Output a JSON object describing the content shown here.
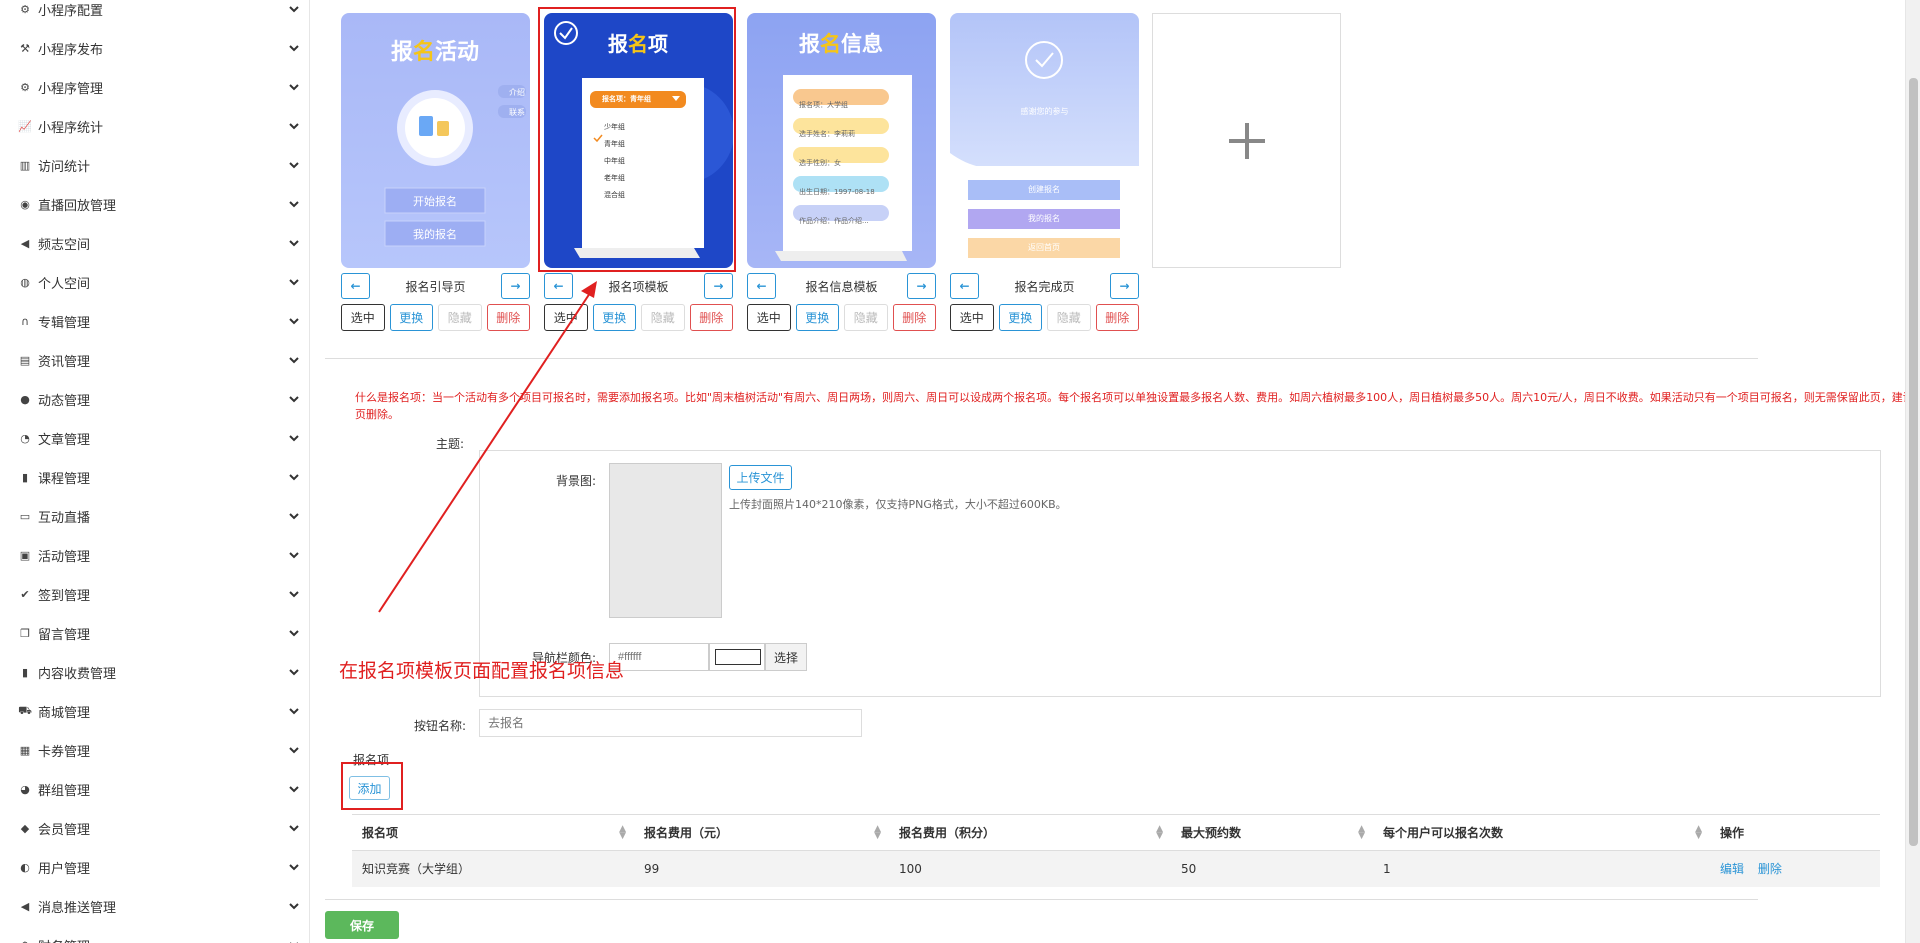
{
  "sidebar": {
    "items": [
      {
        "label": "小程序配置",
        "icon": "cogs-icon"
      },
      {
        "label": "小程序发布",
        "icon": "gavel-icon"
      },
      {
        "label": "小程序管理",
        "icon": "gear-icon"
      },
      {
        "label": "小程序统计",
        "icon": "line-chart-icon"
      },
      {
        "label": "访问统计",
        "icon": "bar-chart-icon"
      },
      {
        "label": "直播回放管理",
        "icon": "broadcast-icon"
      },
      {
        "label": "频志空间",
        "icon": "bullhorn-icon"
      },
      {
        "label": "个人空间",
        "icon": "user-circle-icon"
      },
      {
        "label": "专辑管理",
        "icon": "headphones-icon"
      },
      {
        "label": "资讯管理",
        "icon": "newspaper-icon"
      },
      {
        "label": "动态管理",
        "icon": "comments-icon"
      },
      {
        "label": "文章管理",
        "icon": "wechat-icon"
      },
      {
        "label": "课程管理",
        "icon": "clipboard-icon"
      },
      {
        "label": "互动直播",
        "icon": "desktop-icon"
      },
      {
        "label": "活动管理",
        "icon": "window-icon"
      },
      {
        "label": "签到管理",
        "icon": "check-icon"
      },
      {
        "label": "留言管理",
        "icon": "copy-icon"
      },
      {
        "label": "内容收费管理",
        "icon": "briefcase-icon"
      },
      {
        "label": "商城管理",
        "icon": "cart-icon"
      },
      {
        "label": "卡券管理",
        "icon": "calculator-icon"
      },
      {
        "label": "群组管理",
        "icon": "users-icon"
      },
      {
        "label": "会员管理",
        "icon": "user-icon"
      },
      {
        "label": "用户管理",
        "icon": "user-plus-icon"
      },
      {
        "label": "消息推送管理",
        "icon": "volume-icon"
      },
      {
        "label": "财务管理",
        "icon": "money-icon"
      }
    ]
  },
  "templates": [
    {
      "caption": "报名引导页",
      "title": "报名活动",
      "title_accent_char": "名",
      "buttons": [
        "开始报名",
        "我的报名"
      ],
      "side_tags": [
        "介绍",
        "联系"
      ]
    },
    {
      "caption": "报名项模板",
      "title": "报名项",
      "title_accent_char": "名",
      "dropdown": "报名项：青年组",
      "options": [
        "少年组",
        "青年组",
        "中年组",
        "老年组",
        "混合组"
      ],
      "checked_option": "青年组"
    },
    {
      "caption": "报名信息模板",
      "title": "报名信息",
      "title_accent_char": "名",
      "fields": [
        "报名项：大学组",
        "选手姓名：李莉莉",
        "选手性别：女",
        "出生日期：1997-08-18",
        "作品介绍：作品介绍..."
      ]
    },
    {
      "caption": "报名完成页",
      "message": "感谢您的参与",
      "buttons": [
        "创建报名",
        "我的报名",
        "返回首页"
      ]
    }
  ],
  "template_actions": {
    "select": "选中",
    "change": "更换",
    "hide": "隐藏",
    "delete": "删除"
  },
  "notice": "什么是报名项：当一个活动有多个项目可报名时，需要添加报名项。比如\"周末植树活动\"有周六、周日两场，则周六、周日可以设成两个报名项。每个报名项可以单独设置最多报名人数、费用。如周六植树最多100人，周日植树最多50人。周六10元/人，周日不收费。如果活动只有一个项目可报名，则无需保留此页，建议将此页删除。",
  "form": {
    "theme_label": "主题:",
    "bg_label": "背景图:",
    "upload_btn": "上传文件",
    "upload_hint": "上传封面照片140*210像素，仅支持PNG格式，大小不超过600KB。",
    "navcolor_label": "导航栏颜色:",
    "navcolor_value": "#ffffff",
    "choose_btn": "选择",
    "btn_name_label": "按钮名称:",
    "btn_name_placeholder": "去报名",
    "items_label": "报名项",
    "add_btn": "添加"
  },
  "table": {
    "headers": [
      "报名项",
      "报名费用（元）",
      "报名费用（积分）",
      "最大预约数",
      "每个用户可以报名次数",
      "操作"
    ],
    "rows": [
      {
        "name": "知识竞赛（大学组）",
        "fee": "99",
        "points": "100",
        "max": "50",
        "times": "1",
        "edit": "编辑",
        "del": "删除"
      }
    ]
  },
  "save_btn": "保存",
  "annotation": "在报名项模板页面配置报名项信息",
  "colors": {
    "accent": "#2a94d6",
    "danger": "#e05050",
    "annotation": "#e02020",
    "save": "#5cb85c",
    "gold": "#f5c518"
  }
}
